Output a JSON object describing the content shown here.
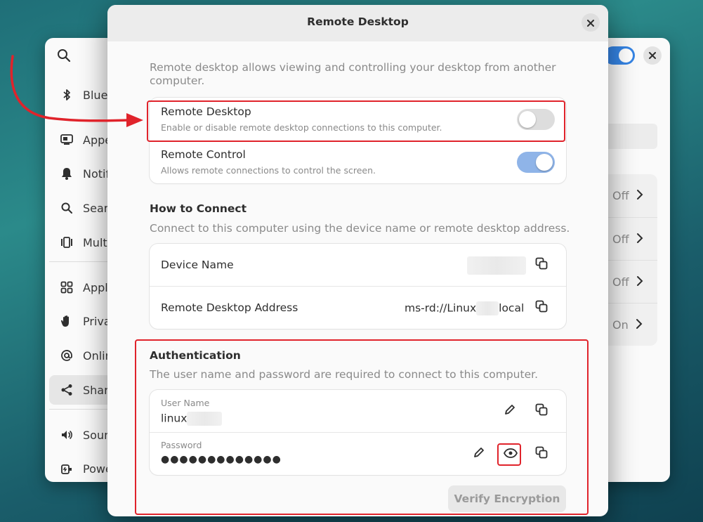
{
  "background_window": {
    "sidebar": [
      {
        "label": "Bluet",
        "icon": "bluetooth-icon"
      },
      {
        "label": "Appe",
        "icon": "appearance-icon"
      },
      {
        "label": "Notif",
        "icon": "bell-icon"
      },
      {
        "label": "Sear",
        "icon": "search-icon"
      },
      {
        "label": "Multi",
        "icon": "multitasking-icon"
      },
      {
        "label": "Appli",
        "icon": "grid-icon"
      },
      {
        "label": "Priva",
        "icon": "hand-icon"
      },
      {
        "label": "Onlin",
        "icon": "at-icon"
      },
      {
        "label": "Shari",
        "icon": "share-icon"
      },
      {
        "label": "Soun",
        "icon": "speaker-icon"
      },
      {
        "label": "Powe",
        "icon": "power-icon"
      }
    ],
    "rows": [
      {
        "value": "Off"
      },
      {
        "value": "Off"
      },
      {
        "value": "Off"
      },
      {
        "value": "On"
      }
    ]
  },
  "dialog": {
    "title": "Remote Desktop",
    "intro": "Remote desktop allows viewing and controlling your desktop from another computer.",
    "toggles": [
      {
        "title": "Remote Desktop",
        "subtitle": "Enable or disable remote desktop connections to this computer.",
        "enabled": false
      },
      {
        "title": "Remote Control",
        "subtitle": "Allows remote connections to control the screen.",
        "enabled": true
      }
    ],
    "how_to_connect": {
      "title": "How to Connect",
      "subtitle": "Connect to this computer using the device name or remote desktop address.",
      "device_name_label": "Device Name",
      "device_name_value": "",
      "address_label": "Remote Desktop Address",
      "address_prefix": "ms-rd://Linux",
      "address_suffix": "local"
    },
    "authentication": {
      "title": "Authentication",
      "subtitle": "The user name and password are required to connect to this computer.",
      "username_label": "User Name",
      "username_value": "linux",
      "password_label": "Password",
      "password_value": "●●●●●●●●●●●●●"
    },
    "verify_button": "Verify Encryption"
  },
  "colors": {
    "highlight": "#e0232b",
    "switch_on": "#8fb4e8",
    "switch_off": "#dddddd",
    "accent": "#3584e4"
  }
}
